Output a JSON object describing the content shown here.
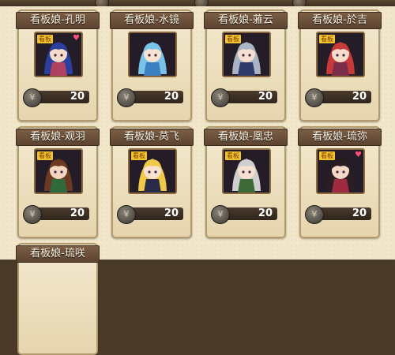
{
  "cards": [
    {
      "title": "看板娘-孔明",
      "badge": "看板",
      "price": "20",
      "hair": "#2b3f9e",
      "dress": "#b04060",
      "skin": "#f6dcc8"
    },
    {
      "title": "看板娘-水镜",
      "badge": "",
      "price": "20",
      "hair": "#79c3e8",
      "dress": "#3c7fc0",
      "skin": "#f8e3d2"
    },
    {
      "title": "看板娘-蕥云",
      "badge": "看板",
      "price": "20",
      "hair": "#a9b4c4",
      "dress": "#2d3a6a",
      "skin": "#f6dfcf"
    },
    {
      "title": "看板娘-於吉",
      "badge": "看板",
      "price": "20",
      "hair": "#c83a3a",
      "dress": "#7a2c4a",
      "skin": "#f7dccb"
    },
    {
      "title": "看板娘-观羽",
      "badge": "看板",
      "price": "20",
      "hair": "#6a3a24",
      "dress": "#2f6b3a",
      "skin": "#f4d6c0"
    },
    {
      "title": "看板娘-莴飞",
      "badge": "看板",
      "price": "20",
      "hair": "#f0c84a",
      "dress": "#2a2a4a",
      "skin": "#f8e2cf"
    },
    {
      "title": "看板娘-凰忠",
      "badge": "看板",
      "price": "20",
      "hair": "#cfcfcf",
      "dress": "#3e6a3a",
      "skin": "#f7e0d0"
    },
    {
      "title": "看板娘-琉弥",
      "badge": "看板",
      "price": "20",
      "hair": "#2a1e22",
      "dress": "#a02a40",
      "skin": "#f6d8c6"
    },
    {
      "title": "看板娘-琉咲",
      "badge": "",
      "price": "",
      "hair": "#6a5050",
      "dress": "#7a3040",
      "skin": "#f6d8c6"
    }
  ],
  "colors": {
    "panel": "#f1e6c9",
    "title_bar": "#6a4f39",
    "accent_badge": "#f2c52e"
  }
}
